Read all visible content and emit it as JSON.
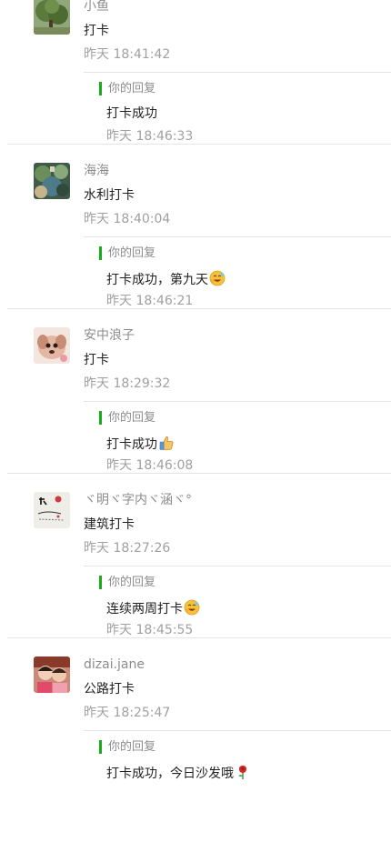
{
  "comments": [
    {
      "nickname": "小鱼",
      "text": "打卡",
      "time": "昨天 18:41:42",
      "reply_label": "你的回复",
      "reply_text": "打卡成功",
      "reply_emoji": "",
      "reply_time": "昨天 18:46:33",
      "avatar_icon": "tree-photo-avatar"
    },
    {
      "nickname": "海海",
      "text": "水利打卡",
      "time": "昨天 18:40:04",
      "reply_label": "你的回复",
      "reply_text": "打卡成功，第九天",
      "reply_emoji": "grin-sweat-emoji",
      "reply_time": "昨天 18:46:21",
      "avatar_icon": "plants-photo-avatar"
    },
    {
      "nickname": "安中浪子",
      "text": "打卡",
      "time": "昨天 18:29:32",
      "reply_label": "你的回复",
      "reply_text": "打卡成功",
      "reply_emoji": "thumbs-up-emoji",
      "reply_time": "昨天 18:46:08",
      "avatar_icon": "puppy-photo-avatar"
    },
    {
      "nickname": "ヾ明ヾ字内ヾ涵ヾ°",
      "text": "建筑打卡",
      "time": "昨天 18:27:26",
      "reply_label": "你的回复",
      "reply_text": "连续两周打卡",
      "reply_emoji": "grin-sweat-emoji",
      "reply_time": "昨天 18:45:55",
      "avatar_icon": "calligraphy-photo-avatar"
    },
    {
      "nickname": "dizai.jane",
      "text": "公路打卡",
      "time": "昨天 18:25:47",
      "reply_label": "你的回复",
      "reply_text": "打卡成功，今日沙发哦",
      "reply_emoji": "rose-emoji",
      "reply_time": "",
      "avatar_icon": "kids-photo-avatar"
    }
  ],
  "colors": {
    "accent_bar": "#1aad19",
    "meta_text": "#a0a0a0",
    "divider": "#e5e5e5"
  }
}
